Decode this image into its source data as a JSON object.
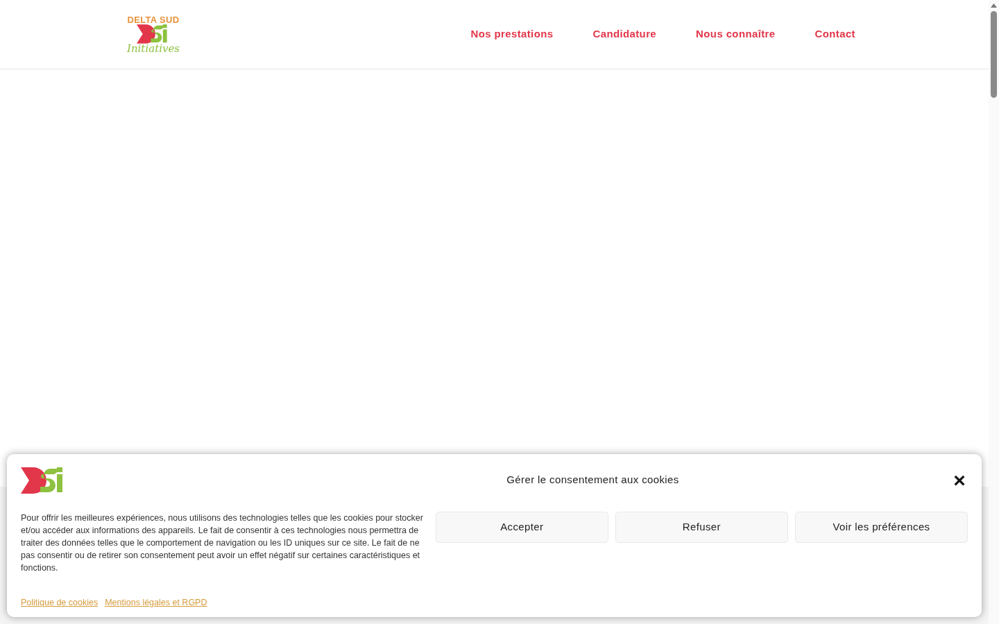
{
  "header": {
    "logo": {
      "top_text": "DELTA SUD",
      "script_text": "Initiatives"
    },
    "nav": [
      {
        "label": "Nos prestations"
      },
      {
        "label": "Candidature"
      },
      {
        "label": "Nous connaître"
      },
      {
        "label": "Contact"
      }
    ]
  },
  "cookie_banner": {
    "title": "Gérer le consentement aux cookies",
    "close": "×",
    "message": "Pour offrir les meilleures expériences, nous utilisons des technologies telles que les cookies pour stocker et/ou accéder aux informations des appareils. Le fait de consentir à ces technologies nous permettra de traiter des données telles que le comportement de navigation ou les ID uniques sur ce site. Le fait de ne pas consentir ou de retirer son consentement peut avoir un effet négatif sur certaines caractéristiques et fonctions.",
    "buttons": [
      {
        "label": "Accepter"
      },
      {
        "label": "Refuser"
      },
      {
        "label": "Voir les préférences"
      }
    ],
    "links": [
      {
        "label": "Politique de cookies"
      },
      {
        "label": "Mentions légales et RGPD"
      }
    ]
  }
}
